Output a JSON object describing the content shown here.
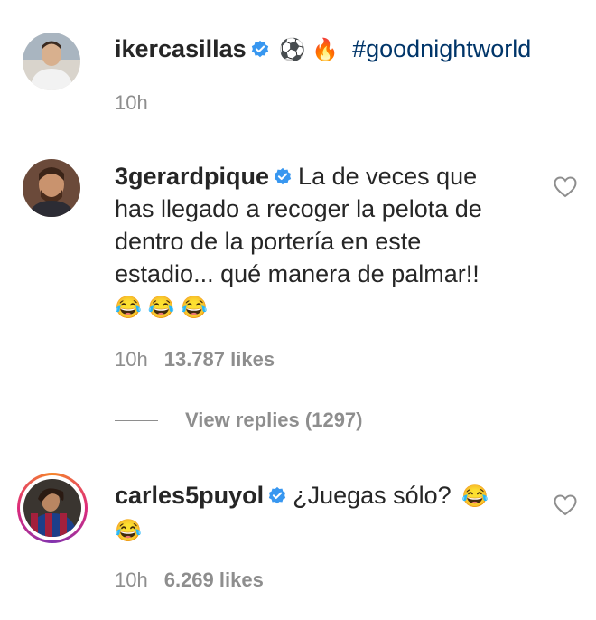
{
  "post": {
    "username": "ikercasillas",
    "caption_emojis": "⚽ 🔥",
    "hashtag": "#goodnightworld",
    "time": "10h"
  },
  "comments": [
    {
      "username": "3gerardpique",
      "text_lines": [
        "La de veces que",
        "has llegado a recoger la pelota de",
        "dentro de la portería en este",
        "estadio... qué manera de palmar!!"
      ],
      "emojis": "😂 😂 😂",
      "time": "10h",
      "likes": "13.787 likes",
      "view_replies": "View replies (1297)"
    },
    {
      "username": "carles5puyol",
      "text": "¿Juegas sólo?",
      "trail_emoji": "😂",
      "emoji_line": "😂",
      "time": "10h",
      "likes": "6.269 likes"
    }
  ],
  "colors": {
    "verified": "#3897f0",
    "hashtag": "#003569",
    "meta": "#8e8e8e",
    "text": "#262626"
  },
  "icons": [
    "verified-badge-icon",
    "heart-icon"
  ]
}
